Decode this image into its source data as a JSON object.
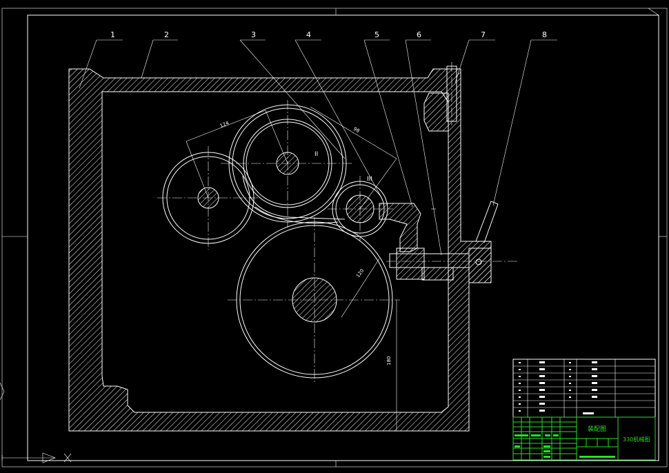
{
  "drawing": {
    "part_labels": [
      "1",
      "2",
      "3",
      "4",
      "5",
      "6",
      "7",
      "8"
    ],
    "dimension_labels": [
      "124",
      "98",
      "120",
      "180"
    ],
    "shaft_labels": [
      "II",
      "III"
    ]
  },
  "title_block": {
    "drawing_name": "装配图",
    "drawing_id": "330机械图"
  },
  "colors": {
    "background": "#000000",
    "lines": "#ffffff",
    "title_block": "#27e027"
  },
  "icons": {
    "ucs": "ucs-axis-icon"
  }
}
